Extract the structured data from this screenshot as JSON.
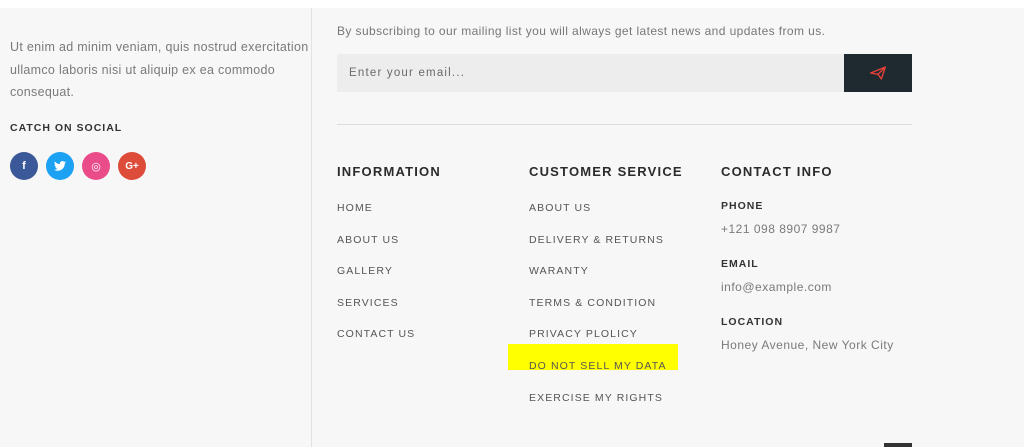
{
  "about": {
    "text": "Ut enim ad minim veniam, quis nostrud exercitation ullamco laboris nisi ut aliquip ex ea commodo consequat.",
    "social_heading": "CATCH ON SOCIAL",
    "social_icons": [
      "facebook-icon",
      "twitter-icon",
      "dribbble-icon",
      "google-plus-icon"
    ],
    "social_glyphs": {
      "facebook": "f",
      "twitter": "t",
      "dribbble": "◎",
      "google": "G+"
    }
  },
  "newsletter": {
    "description": "By subscribing to our mailing list you will always get latest news and updates from us.",
    "email_placeholder": "Enter your email...",
    "send_icon": "paper-plane-icon",
    "send_icon_color": "#e8413b"
  },
  "information": {
    "title": "INFORMATION",
    "links": [
      "HOME",
      "ABOUT US",
      "GALLERY",
      "SERVICES",
      "CONTACT US"
    ]
  },
  "customer_service": {
    "title": "CUSTOMER SERVICE",
    "links": [
      "ABOUT US",
      "DELIVERY & RETURNS",
      "WARANTY",
      "TERMS & CONDITION",
      "PRIVACY PLOLICY",
      "DO NOT SELL MY DATA",
      "EXERCISE MY RIGHTS"
    ],
    "highlight_color": "#ffff00"
  },
  "contact": {
    "title": "CONTACT INFO",
    "phone_label": "PHONE",
    "phone": "+121 098 8907 9987",
    "email_label": "EMAIL",
    "email": "info@example.com",
    "location_label": "LOCATION",
    "location": "Honey Avenue, New York City"
  },
  "colors": {
    "background": "#f7f7f8",
    "button_dark": "#1e2a30",
    "facebook": "#3b5998",
    "twitter": "#1da1f2",
    "dribbble": "#ea4c89",
    "google": "#dd4b39"
  }
}
